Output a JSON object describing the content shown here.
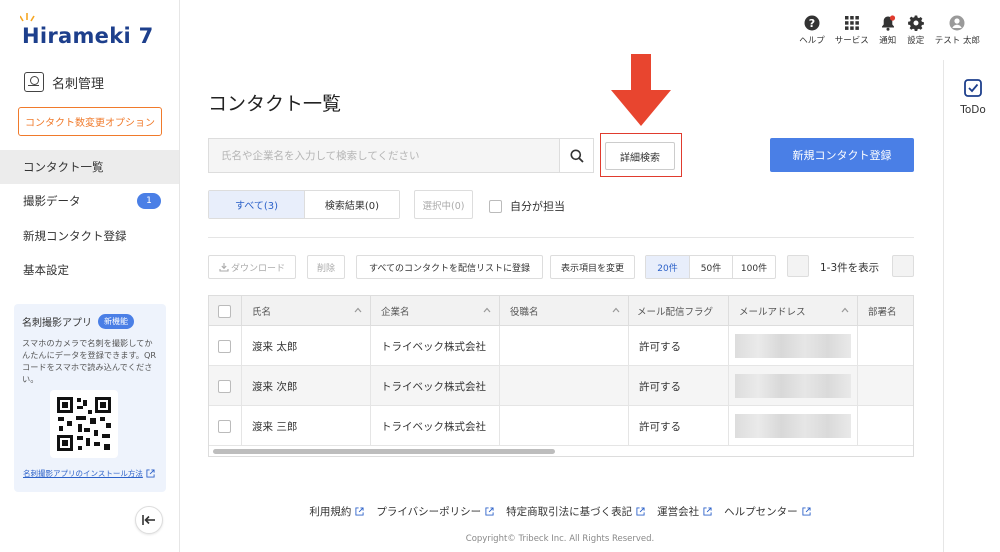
{
  "brand": {
    "logo_text": "Hirameki 7"
  },
  "sidebar": {
    "section_title": "名刺管理",
    "option_button": "コンタクト数変更オプション",
    "items": [
      {
        "label": "コンタクト一覧",
        "active": true
      },
      {
        "label": "撮影データ",
        "badge": "1"
      },
      {
        "label": "新規コンタクト登録"
      },
      {
        "label": "基本設定"
      }
    ],
    "app_box": {
      "title": "名刺撮影アプリ",
      "tag": "新機能",
      "description": "スマホのカメラで名刺を撮影してかんたんにデータを登録できます。QRコードをスマホで読み込んでください。",
      "install_link": "名刺撮影アプリのインストール方法"
    }
  },
  "header": {
    "items": [
      {
        "label": "ヘルプ",
        "icon": "help-icon"
      },
      {
        "label": "サービス",
        "icon": "grid-icon"
      },
      {
        "label": "通知",
        "icon": "bell-icon"
      },
      {
        "label": "設定",
        "icon": "gear-icon"
      },
      {
        "label": "テスト 太郎",
        "icon": "user-icon"
      }
    ]
  },
  "todo": {
    "label": "ToDo"
  },
  "main": {
    "title": "コンタクト一覧",
    "search_placeholder": "氏名や企業名を入力して検索してください",
    "advanced_search": "詳細検索",
    "new_contact": "新規コンタクト登録",
    "tabs": [
      {
        "label": "すべて(3)",
        "active": true
      },
      {
        "label": "検索結果(0)"
      }
    ],
    "selected_button": "選択中(0)",
    "mine_label": "自分が担当",
    "toolbar": {
      "download": "ダウンロード",
      "delete": "削除",
      "register_all": "すべてのコンタクトを配信リストに登録",
      "change_columns": "表示項目を変更",
      "page_sizes": [
        "20件",
        "50件",
        "100件"
      ],
      "count_text": "1-3件を表示"
    },
    "table": {
      "columns": [
        "氏名",
        "企業名",
        "役職名",
        "メール配信フラグ",
        "メールアドレス",
        "部署名"
      ],
      "rows": [
        {
          "name": "渡来 太郎",
          "company": "トライベック株式会社",
          "title": "",
          "flag": "許可する"
        },
        {
          "name": "渡来 次郎",
          "company": "トライベック株式会社",
          "title": "",
          "flag": "許可する"
        },
        {
          "name": "渡来 三郎",
          "company": "トライベック株式会社",
          "title": "",
          "flag": "許可する"
        }
      ]
    }
  },
  "footer": {
    "links": [
      "利用規約",
      "プライバシーポリシー",
      "特定商取引法に基づく表記",
      "運営会社",
      "ヘルプセンター"
    ],
    "copyright": "Copyright© Tribeck Inc. All Rights Reserved."
  },
  "colors": {
    "primary": "#4a7fe6",
    "accent_orange": "#f07a2b",
    "highlight_red": "#e03b2e",
    "brand_navy": "#1d3f8c"
  }
}
